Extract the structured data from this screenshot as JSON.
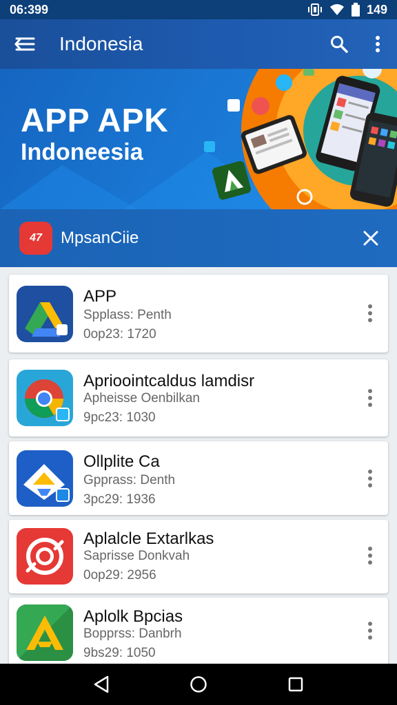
{
  "status": {
    "time": "06:399",
    "battery": "149"
  },
  "app_bar": {
    "title": "Indonesia",
    "icons": [
      "menu-icon",
      "search-icon",
      "more-vert-icon"
    ]
  },
  "banner": {
    "title": "APP APK",
    "subtitle": "Indoneesia"
  },
  "promo": {
    "icon_text": "47",
    "label": "MpsanCiie"
  },
  "apps": [
    {
      "name": "APP",
      "developer": "Spplass: Penth",
      "meta": "0op23: 1720",
      "icon": "drive-icon"
    },
    {
      "name": "Aprioointcaldus lamdisr",
      "developer": "Apheisse Oenbilkan",
      "meta": "9pc23: 1030",
      "icon": "chrome-icon"
    },
    {
      "name": "Ollplite Ca",
      "developer": "Gpprass: Denth",
      "meta": "3pc29: 1936",
      "icon": "drive-alt-icon"
    },
    {
      "name": "Aplalcle Extarlkas",
      "developer": "Saprisse Donkvah",
      "meta": "0op29: 2956",
      "icon": "red-app-icon"
    },
    {
      "name": "Aplolk Bpcias",
      "developer": "Bopprss: Danbrh",
      "meta": "9bs29: 1050",
      "icon": "green-a-icon"
    }
  ],
  "nav": {
    "buttons": [
      "back-icon",
      "home-icon",
      "recents-icon"
    ]
  },
  "colors": {
    "app_bar": "#1a4f9a",
    "banner": "#1976d2",
    "promo": "#1f6bc0",
    "accent_orange": "#f57c00"
  }
}
